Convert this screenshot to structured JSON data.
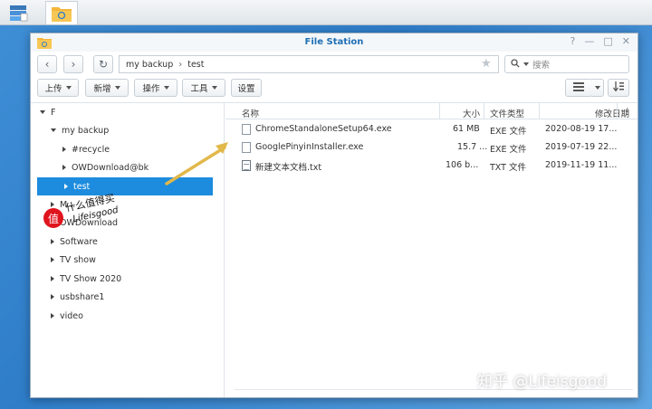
{
  "taskbar": {
    "apps": [
      {
        "icon": "synology-app-icon"
      },
      {
        "icon": "file-station-folder-icon"
      }
    ]
  },
  "window": {
    "title": "File Station",
    "controls": [
      "?",
      "—",
      "□",
      "✕"
    ]
  },
  "address": {
    "path": [
      "my backup",
      "test"
    ],
    "search_placeholder": "搜索"
  },
  "toolbar": {
    "upload": "上传",
    "new": "新增",
    "action": "操作",
    "tools": "工具",
    "settings": "设置"
  },
  "sidebar": {
    "root": "F",
    "items": [
      {
        "label": "my backup"
      },
      {
        "label": "#recycle"
      },
      {
        "label": "OWDownload@bk"
      },
      {
        "label": "test"
      },
      {
        "label": "M..."
      },
      {
        "label": "OWDownload"
      },
      {
        "label": "Software"
      },
      {
        "label": "TV show"
      },
      {
        "label": "TV Show 2020"
      },
      {
        "label": "usbshare1"
      },
      {
        "label": "video"
      }
    ]
  },
  "filelist": {
    "columns": {
      "name": "名称",
      "size": "大小",
      "type": "文件类型",
      "modified": "修改日期"
    },
    "rows": [
      {
        "name": "ChromeStandaloneSetup64.exe",
        "size": "61 MB",
        "type": "EXE 文件",
        "modified": "2020-08-19 17..."
      },
      {
        "name": "GooglePinyinInstaller.exe",
        "size": "15.7 ...",
        "type": "EXE 文件",
        "modified": "2019-07-19 22..."
      },
      {
        "name": "新建文本文档.txt",
        "size": "106 b...",
        "type": "TXT 文件",
        "modified": "2019-11-19 11..."
      }
    ]
  },
  "watermark": {
    "stamp": "值",
    "line1": "什么值得买",
    "line2": "Lifeisgood",
    "bottom": "知乎 @Lifeisgood"
  },
  "colors": {
    "accent": "#1d8cde",
    "title": "#1f6fb5",
    "arrow": "#e2b84a"
  }
}
